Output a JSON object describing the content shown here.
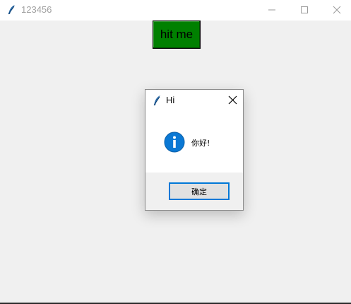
{
  "window": {
    "title": "123456",
    "icon": "feather-icon",
    "controls": [
      "minimize-icon",
      "maximize-icon",
      "close-icon"
    ]
  },
  "main": {
    "hit_button_label": "hit me",
    "hit_button_color": "#008000"
  },
  "dialog": {
    "title": "Hi",
    "icon": "feather-icon",
    "message": "你好!",
    "message_icon": "info-icon",
    "ok_label": "确定",
    "accent": "#0078d7"
  }
}
